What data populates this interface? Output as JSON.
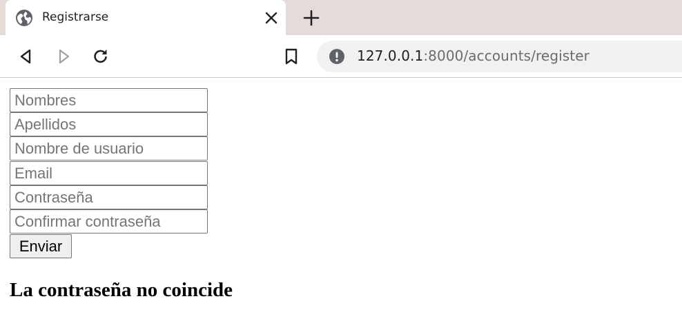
{
  "browser": {
    "tab": {
      "title": "Registrarse",
      "favicon": "globe-icon",
      "close_icon": "close-icon"
    },
    "new_tab_icon": "plus-icon",
    "nav": {
      "back_icon": "back-icon",
      "forward_icon": "forward-icon",
      "reload_icon": "reload-icon",
      "bookmark_icon": "bookmark-icon"
    },
    "address": {
      "security_icon": "info-icon",
      "host": "127.0.0.1",
      "path": ":8000/accounts/register"
    },
    "colors": {
      "tabstrip": "#e5dbd9",
      "omnibox": "#f1f1f1"
    }
  },
  "form": {
    "fields": {
      "first_name": {
        "placeholder": "Nombres",
        "value": ""
      },
      "last_name": {
        "placeholder": "Apellidos",
        "value": ""
      },
      "username": {
        "placeholder": "Nombre de usuario",
        "value": ""
      },
      "email": {
        "placeholder": "Email",
        "value": ""
      },
      "password": {
        "placeholder": "Contraseña",
        "value": ""
      },
      "password_confirm": {
        "placeholder": "Confirmar contraseña",
        "value": ""
      }
    },
    "submit_label": "Enviar",
    "error_message": "La contraseña no coincide"
  }
}
